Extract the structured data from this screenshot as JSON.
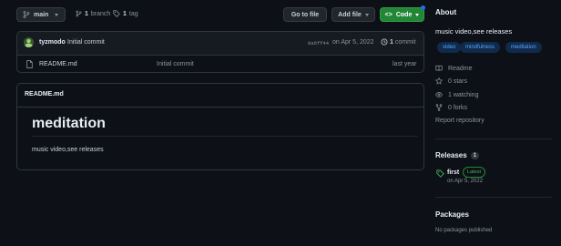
{
  "toolbar": {
    "branch_label": "main",
    "branch_count": "1",
    "branch_word": "branch",
    "tag_count": "1",
    "tag_word": "tag",
    "goto_file": "Go to file",
    "add_file": "Add file",
    "code": "Code"
  },
  "commit": {
    "author": "tyzmodo",
    "message": "Initial commit",
    "sha": "8a6ff44",
    "date": "on Apr 5, 2022",
    "count": "1",
    "count_word": "commit"
  },
  "files": [
    {
      "name": "README.md",
      "message": "Initial commit",
      "age": "last year"
    }
  ],
  "readme": {
    "header": "README.md",
    "title": "meditation",
    "body": "music video,see releases"
  },
  "about": {
    "heading": "About",
    "description": "music video,see releases",
    "topics": [
      "video",
      "mindfulness",
      "meditation"
    ],
    "readme": "Readme",
    "stars": "0 stars",
    "watching": "1 watching",
    "forks": "0 forks",
    "report": "Report repository"
  },
  "releases": {
    "heading": "Releases",
    "count": "1",
    "name": "first",
    "badge": "Latest",
    "date": "on Apr 5, 2022"
  },
  "packages": {
    "heading": "Packages",
    "empty": "No packages published"
  },
  "colors": {
    "accent_green": "#238636",
    "link_blue": "#58a6ff",
    "background": "#0d1117",
    "notification_dot": "#1f6feb"
  }
}
